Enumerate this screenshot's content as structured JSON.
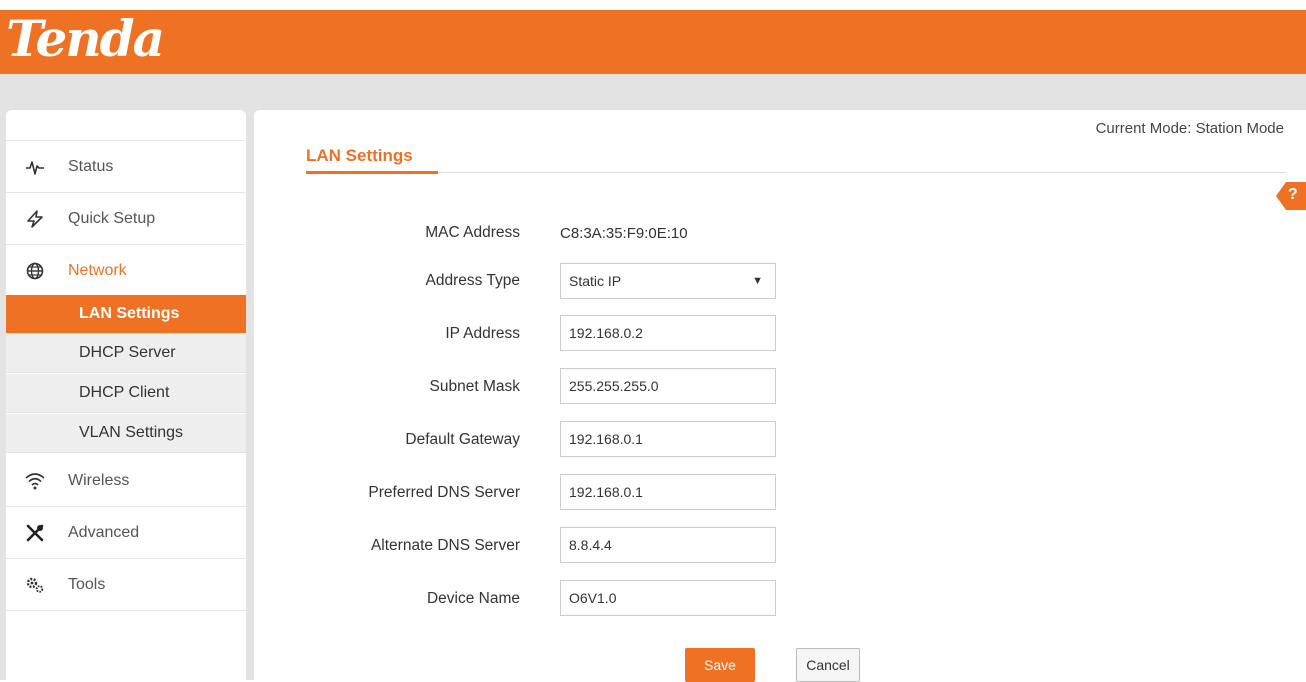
{
  "brand": {
    "logo_text": "Tenda",
    "accent_color": "#ee7124"
  },
  "sidebar": {
    "items": [
      {
        "label": "Status",
        "icon": "pulse-icon"
      },
      {
        "label": "Quick Setup",
        "icon": "lightning-icon"
      },
      {
        "label": "Network",
        "icon": "globe-icon",
        "active": true
      },
      {
        "label": "Wireless",
        "icon": "wifi-icon"
      },
      {
        "label": "Advanced",
        "icon": "tools-icon"
      },
      {
        "label": "Tools",
        "icon": "gears-icon"
      }
    ],
    "network_subitems": [
      {
        "label": "LAN Settings",
        "selected": true
      },
      {
        "label": "DHCP Server"
      },
      {
        "label": "DHCP Client"
      },
      {
        "label": "VLAN Settings"
      }
    ]
  },
  "header": {
    "current_mode": "Current Mode: Station Mode"
  },
  "page": {
    "title": "LAN Settings",
    "help_label": "?"
  },
  "form": {
    "mac_address": {
      "label": "MAC Address",
      "value": "C8:3A:35:F9:0E:10"
    },
    "address_type": {
      "label": "Address Type",
      "value": "Static IP"
    },
    "ip_address": {
      "label": "IP Address",
      "value": "192.168.0.2"
    },
    "subnet_mask": {
      "label": "Subnet Mask",
      "value": "255.255.255.0"
    },
    "default_gateway": {
      "label": "Default Gateway",
      "value": "192.168.0.1"
    },
    "preferred_dns": {
      "label": "Preferred DNS Server",
      "value": "192.168.0.1"
    },
    "alternate_dns": {
      "label": "Alternate DNS Server",
      "value": "8.8.4.4"
    },
    "device_name": {
      "label": "Device Name",
      "value": "O6V1.0"
    }
  },
  "buttons": {
    "save": "Save",
    "cancel": "Cancel"
  }
}
